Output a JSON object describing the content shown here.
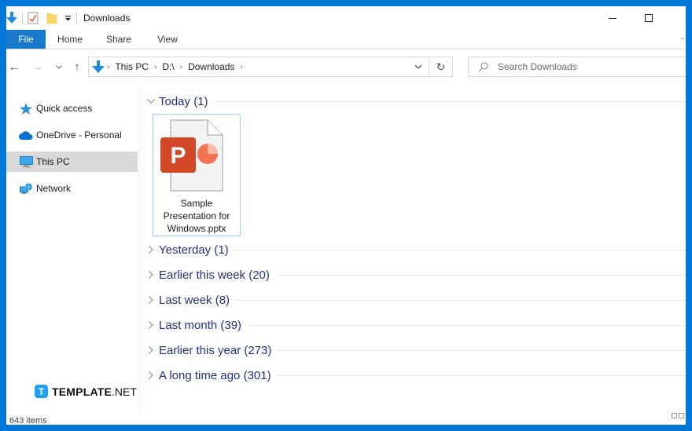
{
  "window": {
    "title": "Downloads",
    "controls": {
      "minimize": "minimize",
      "maximize": "maximize"
    }
  },
  "quick_access_toolbar": {
    "icons": [
      "download-arrow-icon",
      "properties-icon",
      "new-folder-icon",
      "customize-dropdown-icon"
    ]
  },
  "ribbon": {
    "tabs": [
      {
        "label": "File",
        "active": true
      },
      {
        "label": "Home"
      },
      {
        "label": "Share"
      },
      {
        "label": "View"
      }
    ],
    "expand_chevron": "⌄"
  },
  "address_bar": {
    "nav": {
      "back": "←",
      "forward": "→",
      "recent": "⌄",
      "up": "↑"
    },
    "breadcrumb": [
      "This PC",
      "D:\\",
      "Downloads"
    ],
    "refresh": "↻",
    "search_placeholder": "Search Downloads"
  },
  "sidebar": {
    "items": [
      {
        "label": "Quick access",
        "icon": "star-icon"
      },
      {
        "label": "OneDrive - Personal",
        "icon": "cloud-icon"
      },
      {
        "label": "This PC",
        "icon": "monitor-icon",
        "selected": true
      },
      {
        "label": "Network",
        "icon": "network-icon"
      }
    ]
  },
  "content": {
    "groups": [
      {
        "label": "Today (1)",
        "expanded": true
      },
      {
        "label": "Yesterday (1)",
        "expanded": false
      },
      {
        "label": "Earlier this week (20)",
        "expanded": false
      },
      {
        "label": "Last week (8)",
        "expanded": false
      },
      {
        "label": "Last month (39)",
        "expanded": false
      },
      {
        "label": "Earlier this year (273)",
        "expanded": false
      },
      {
        "label": "A long time ago (301)",
        "expanded": false
      }
    ],
    "files": [
      {
        "name_lines": [
          "Sample",
          "Presentation for",
          "Windows.pptx"
        ],
        "icon": "powerpoint-file-icon",
        "icon_letter": "P"
      }
    ]
  },
  "status_bar": {
    "item_count": "643 items"
  },
  "watermark": {
    "badge": "T",
    "brand": "TEMPLATE",
    "suffix": ".NET"
  },
  "colors": {
    "accent": "#0078d7",
    "file_tab": "#1979ca",
    "group_label": "#1e3287",
    "ppt_red": "#d24726",
    "selected_bg": "#d9d9d9"
  }
}
